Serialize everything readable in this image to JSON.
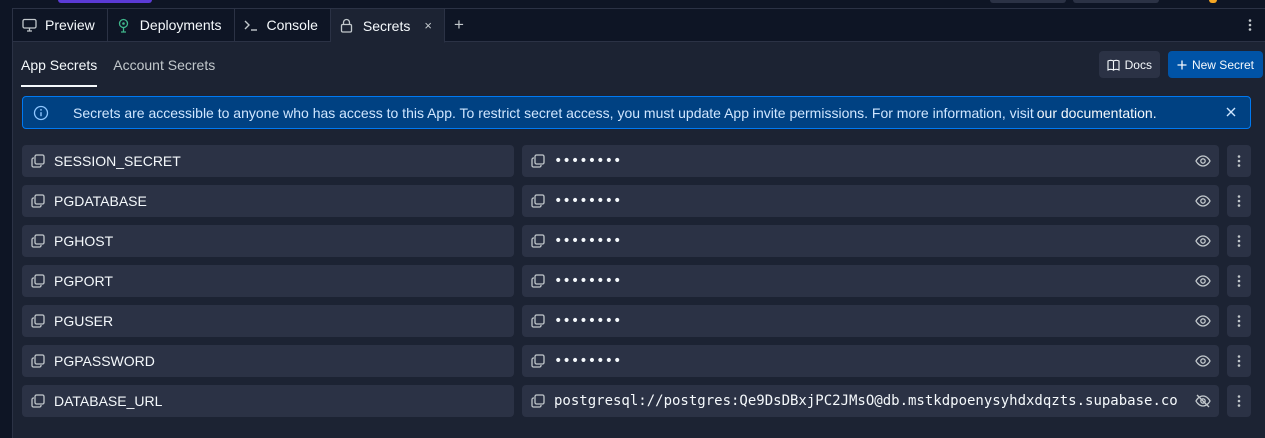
{
  "tabs": [
    {
      "label": "Preview",
      "icon": "monitor-icon"
    },
    {
      "label": "Deployments",
      "icon": "deployments-icon"
    },
    {
      "label": "Console",
      "icon": "terminal-icon"
    },
    {
      "label": "Secrets",
      "icon": "lock-icon",
      "active": true,
      "close": "×"
    }
  ],
  "tab_add": "+",
  "subtabs": {
    "app": "App Secrets",
    "account": "Account Secrets"
  },
  "actions": {
    "docs": "Docs",
    "new_secret": "New Secret"
  },
  "banner": {
    "text": "Secrets are accessible to anyone who has access to this App. To restrict secret access, you must update App invite permissions. For more information, visit",
    "link": "our documentation."
  },
  "secrets": [
    {
      "key": "SESSION_SECRET",
      "value": "••••••••",
      "revealed": false
    },
    {
      "key": "PGDATABASE",
      "value": "••••••••",
      "revealed": false
    },
    {
      "key": "PGHOST",
      "value": "••••••••",
      "revealed": false
    },
    {
      "key": "PGPORT",
      "value": "••••••••",
      "revealed": false
    },
    {
      "key": "PGUSER",
      "value": "••••••••",
      "revealed": false
    },
    {
      "key": "PGPASSWORD",
      "value": "••••••••",
      "revealed": false
    },
    {
      "key": "DATABASE_URL",
      "value": "postgresql://postgres:Qe9DsDBxjPC2JMsO@db.mstkdpoenysyhdxdqzts.supabase.co",
      "revealed": true
    }
  ],
  "colors": {
    "background": "#0e1525",
    "surface": "#1c2333",
    "field": "#2b3245",
    "primary": "#0053a6",
    "banner": "#004182",
    "banner_border": "#0079f2"
  }
}
